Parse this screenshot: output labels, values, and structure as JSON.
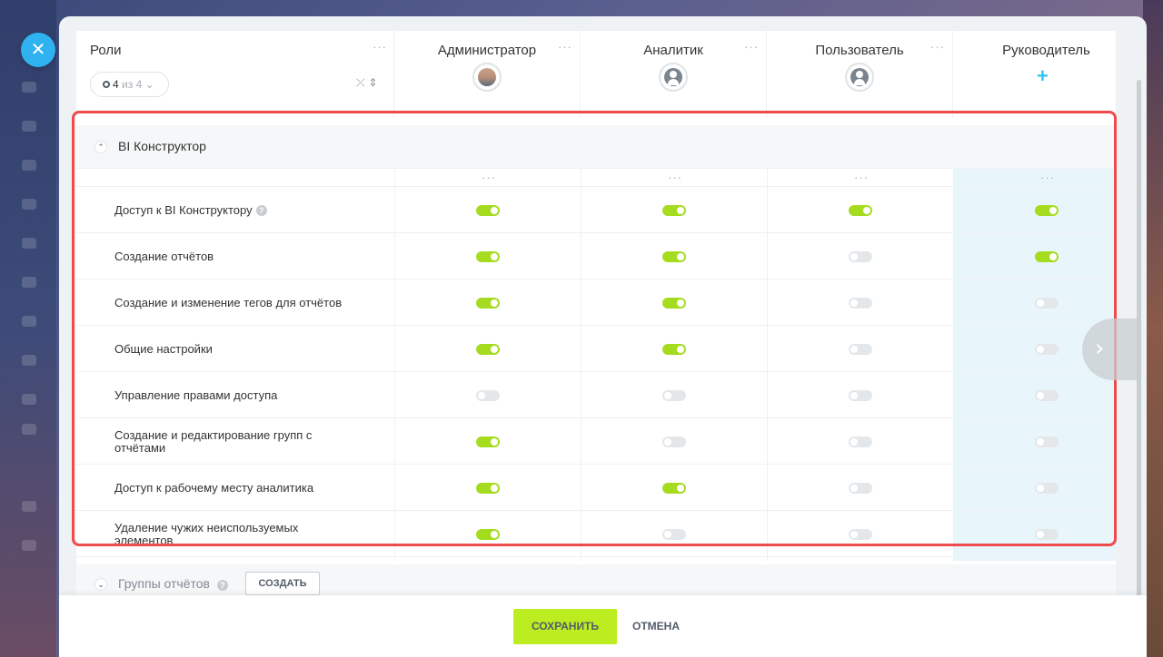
{
  "header": {
    "roles_title": "Роли",
    "counter_current": "4",
    "counter_rest": "из 4",
    "columns": [
      {
        "name": "Администратор",
        "avatar": "photo"
      },
      {
        "name": "Аналитик",
        "avatar": "user"
      },
      {
        "name": "Пользователь",
        "avatar": "user"
      },
      {
        "name": "Руководитель",
        "avatar": "plus"
      }
    ]
  },
  "section": {
    "title": "BI Конструктор",
    "rows": [
      {
        "label": "Доступ к BI Конструктору",
        "help": true,
        "values": [
          true,
          true,
          true,
          true
        ]
      },
      {
        "label": "Создание отчётов",
        "help": false,
        "values": [
          true,
          true,
          false,
          true
        ]
      },
      {
        "label": "Создание и изменение тегов для отчётов",
        "help": false,
        "values": [
          true,
          true,
          false,
          false
        ]
      },
      {
        "label": "Общие настройки",
        "help": false,
        "values": [
          true,
          true,
          false,
          false
        ]
      },
      {
        "label": "Управление правами доступа",
        "help": false,
        "values": [
          false,
          false,
          false,
          false
        ]
      },
      {
        "label": "Создание и редактирование групп с отчётами",
        "help": false,
        "values": [
          true,
          false,
          false,
          false
        ]
      },
      {
        "label": "Доступ к рабочему месту аналитика",
        "help": false,
        "values": [
          true,
          true,
          false,
          false
        ]
      },
      {
        "label": "Удаление чужих неиспользуемых элементов",
        "help": false,
        "values": [
          true,
          false,
          false,
          false
        ]
      }
    ]
  },
  "groups": {
    "title": "Группы отчётов",
    "create_label": "СОЗДАТЬ"
  },
  "footer": {
    "save_label": "СОХРАНИТЬ",
    "cancel_label": "ОТМЕНА"
  },
  "colors": {
    "toggle_on": "#a5dc1f",
    "highlight": "#e8f6fc",
    "frame": "#ee4b4b",
    "save": "#bbed21"
  }
}
